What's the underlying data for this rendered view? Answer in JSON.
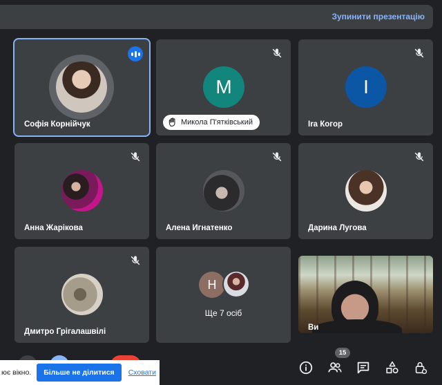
{
  "header": {
    "stop_presenting_label": "Зупинити презентацію"
  },
  "participants": [
    {
      "name": "Софія Корнійчук",
      "speaking": true,
      "active": true
    },
    {
      "name": "Микола П'ятківський",
      "avatar_letter": "M",
      "avatar_color": "#12857d",
      "hand_raised": true,
      "muted": true
    },
    {
      "name": "Іra Когор",
      "avatar_letter": "I",
      "avatar_color": "#0b57a5",
      "muted": true
    },
    {
      "name": "Анна Жарікова",
      "muted": true
    },
    {
      "name": "Алена Игнатенко",
      "muted": true
    },
    {
      "name": "Дарина Лугова",
      "muted": true
    },
    {
      "name": "Дмитро Грігалашвілі",
      "muted": true
    },
    {
      "name": "Ще 7 осіб",
      "others_letter": "H",
      "others_color": "#8d6e63"
    },
    {
      "name": "Ви",
      "video": true
    }
  ],
  "controls": {
    "participants_count": "15"
  },
  "share_toast": {
    "text": "ює вікно.",
    "primary_button": "Більше не ділитися",
    "hide_link": "Сховати"
  },
  "colors": {
    "accent": "#8ab4f8",
    "tile_bg": "#3c4043",
    "background": "#202124",
    "end_call": "#ea4335"
  }
}
